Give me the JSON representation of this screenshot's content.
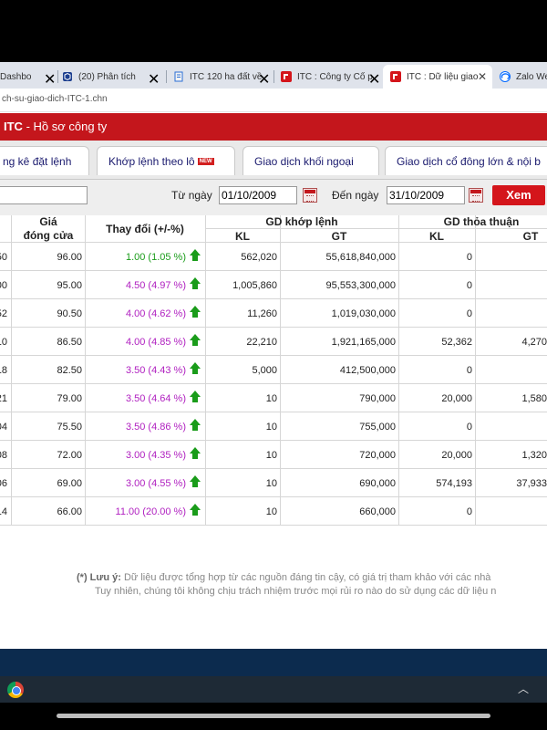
{
  "browser": {
    "tabs": [
      {
        "label": "Dashbo",
        "icon": "dashboard-icon",
        "active": false
      },
      {
        "label": "(20) Phân tích",
        "icon": "cube-icon",
        "active": false
      },
      {
        "label": "ITC 120 ha đất về",
        "icon": "page-icon",
        "active": false
      },
      {
        "label": "ITC : Công ty Cổ p",
        "icon": "red-logo-icon",
        "active": false
      },
      {
        "label": "ITC : Dữ liệu giao",
        "icon": "red-logo-icon",
        "active": true
      },
      {
        "label": "Zalo We",
        "icon": "zalo-icon",
        "active": false
      }
    ],
    "url": "ch-su-giao-dich-ITC-1.chn"
  },
  "header": {
    "ticker": "ITC",
    "dash": " - ",
    "subtitle": "Hồ sơ công ty"
  },
  "section_tabs": [
    {
      "label": "ng kê đặt lệnh"
    },
    {
      "label": "Khớp lệnh theo lô",
      "badge": "NEW"
    },
    {
      "label": "Giao dịch khối ngoại"
    },
    {
      "label": "Giao dịch cổ đông lớn & nội b"
    }
  ],
  "filter": {
    "from_label": "Từ ngày",
    "from_value": "01/10/2009",
    "to_label": "Đến ngày",
    "to_value": "31/10/2009",
    "view_button": "Xem"
  },
  "table": {
    "headers": {
      "close_line1": "Giá",
      "close_line2": "đóng cửa",
      "change": "Thay đổi (+/-%)",
      "matched": "GD khớp lệnh",
      "negotiated": "GD thỏa thuận",
      "kl": "KL",
      "gt": "GT"
    },
    "rows": [
      {
        "prev": "50",
        "close": "96.00",
        "change": "1.00 (1.05 %)",
        "change_color": "#1a9c1a",
        "m_kl": "562,020",
        "m_gt": "55,618,840,000",
        "n_kl": "0",
        "n_gt": ""
      },
      {
        "prev": "00",
        "close": "95.00",
        "change": "4.50 (4.97 %)",
        "change_color": "#b020c0",
        "m_kl": "1,005,860",
        "m_gt": "95,553,300,000",
        "n_kl": "0",
        "n_gt": ""
      },
      {
        "prev": "52",
        "close": "90.50",
        "change": "4.00 (4.62 %)",
        "change_color": "#b020c0",
        "m_kl": "11,260",
        "m_gt": "1,019,030,000",
        "n_kl": "0",
        "n_gt": ""
      },
      {
        "prev": "10",
        "close": "86.50",
        "change": "4.00 (4.85 %)",
        "change_color": "#b020c0",
        "m_kl": "22,210",
        "m_gt": "1,921,165,000",
        "n_kl": "52,362",
        "n_gt": "4,270"
      },
      {
        "prev": "18",
        "close": "82.50",
        "change": "3.50 (4.43 %)",
        "change_color": "#b020c0",
        "m_kl": "5,000",
        "m_gt": "412,500,000",
        "n_kl": "0",
        "n_gt": ""
      },
      {
        "prev": "21",
        "close": "79.00",
        "change": "3.50 (4.64 %)",
        "change_color": "#b020c0",
        "m_kl": "10",
        "m_gt": "790,000",
        "n_kl": "20,000",
        "n_gt": "1,580"
      },
      {
        "prev": "04",
        "close": "75.50",
        "change": "3.50 (4.86 %)",
        "change_color": "#b020c0",
        "m_kl": "10",
        "m_gt": "755,000",
        "n_kl": "0",
        "n_gt": ""
      },
      {
        "prev": "08",
        "close": "72.00",
        "change": "3.00 (4.35 %)",
        "change_color": "#b020c0",
        "m_kl": "10",
        "m_gt": "720,000",
        "n_kl": "20,000",
        "n_gt": "1,320"
      },
      {
        "prev": "06",
        "close": "69.00",
        "change": "3.00 (4.55 %)",
        "change_color": "#b020c0",
        "m_kl": "10",
        "m_gt": "690,000",
        "n_kl": "574,193",
        "n_gt": "37,933"
      },
      {
        "prev": "14",
        "close": "66.00",
        "change": "11.00 (20.00 %)",
        "change_color": "#b020c0",
        "m_kl": "10",
        "m_gt": "660,000",
        "n_kl": "0",
        "n_gt": ""
      }
    ]
  },
  "note": {
    "line1_prefix": "(*) Lưu ý:",
    "line1": " Dữ liệu được tổng hợp từ các nguồn đáng tin cậy, có giá trị tham khảo với các nhà",
    "line2": "Tuy nhiên, chúng tôi không chịu trách nhiệm trước mọi rủi ro nào do sử dụng các dữ liệu n"
  },
  "colors": {
    "brand_red": "#c4161c",
    "up_green": "#1a9c1a",
    "ceiling_purple": "#b020c0"
  }
}
